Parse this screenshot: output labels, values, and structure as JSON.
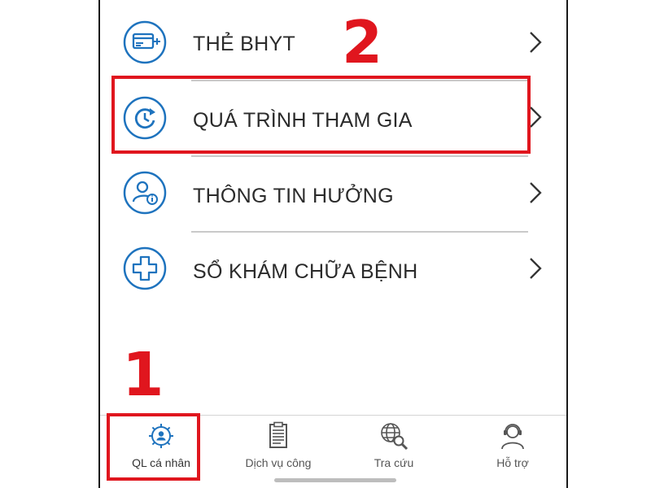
{
  "menu": {
    "items": [
      {
        "label": "THẺ BHYT",
        "icon": "health-insurance-card-icon"
      },
      {
        "label": "QUÁ TRÌNH THAM GIA",
        "icon": "history-clock-icon"
      },
      {
        "label": "THÔNG TIN HƯỞNG",
        "icon": "user-info-icon"
      },
      {
        "label": "SỔ KHÁM CHỮA BỆNH",
        "icon": "medical-cross-icon"
      }
    ],
    "chevron_icon": "chevron-right-icon"
  },
  "tabbar": {
    "tabs": [
      {
        "label": "QL cá nhân",
        "icon": "personal-gear-icon"
      },
      {
        "label": "Dịch vụ công",
        "icon": "document-icon"
      },
      {
        "label": "Tra cứu",
        "icon": "globe-search-icon"
      },
      {
        "label": "Hỗ trợ",
        "icon": "support-person-icon"
      }
    ]
  },
  "annotations": {
    "step1": "1",
    "step2": "2",
    "color": "#e0161e"
  },
  "colors": {
    "icon_blue": "#1e73be",
    "text": "#2b2b2b",
    "highlight": "#e0161e"
  }
}
